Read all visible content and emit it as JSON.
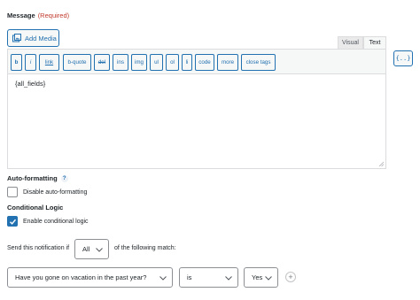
{
  "message": {
    "label": "Message",
    "required": "(Required)",
    "add_media_label": "Add Media",
    "tabs": [
      "Visual",
      "Text"
    ],
    "quicktags": [
      "b",
      "i",
      "link",
      "b-quote",
      "del",
      "ins",
      "img",
      "ul",
      "ol",
      "li",
      "code",
      "more",
      "close tags"
    ],
    "content": "{all_fields}",
    "merge_tag_label": "{..}"
  },
  "auto_formatting": {
    "label": "Auto-formatting",
    "help": "?",
    "checkbox_label": "Disable auto-formatting",
    "checked": false
  },
  "conditional_logic": {
    "label": "Conditional Logic",
    "checkbox_label": "Enable conditional logic",
    "checked": true,
    "send_prefix": "Send this notification if",
    "match_value": "All",
    "send_suffix": "of the following match:",
    "rule": {
      "field": "Have you gone on vacation in the past year?",
      "operator": "is",
      "value": "Yes"
    },
    "add_rule": "+"
  },
  "colors": {
    "accent": "#2271b1",
    "required": "#c0392b"
  }
}
